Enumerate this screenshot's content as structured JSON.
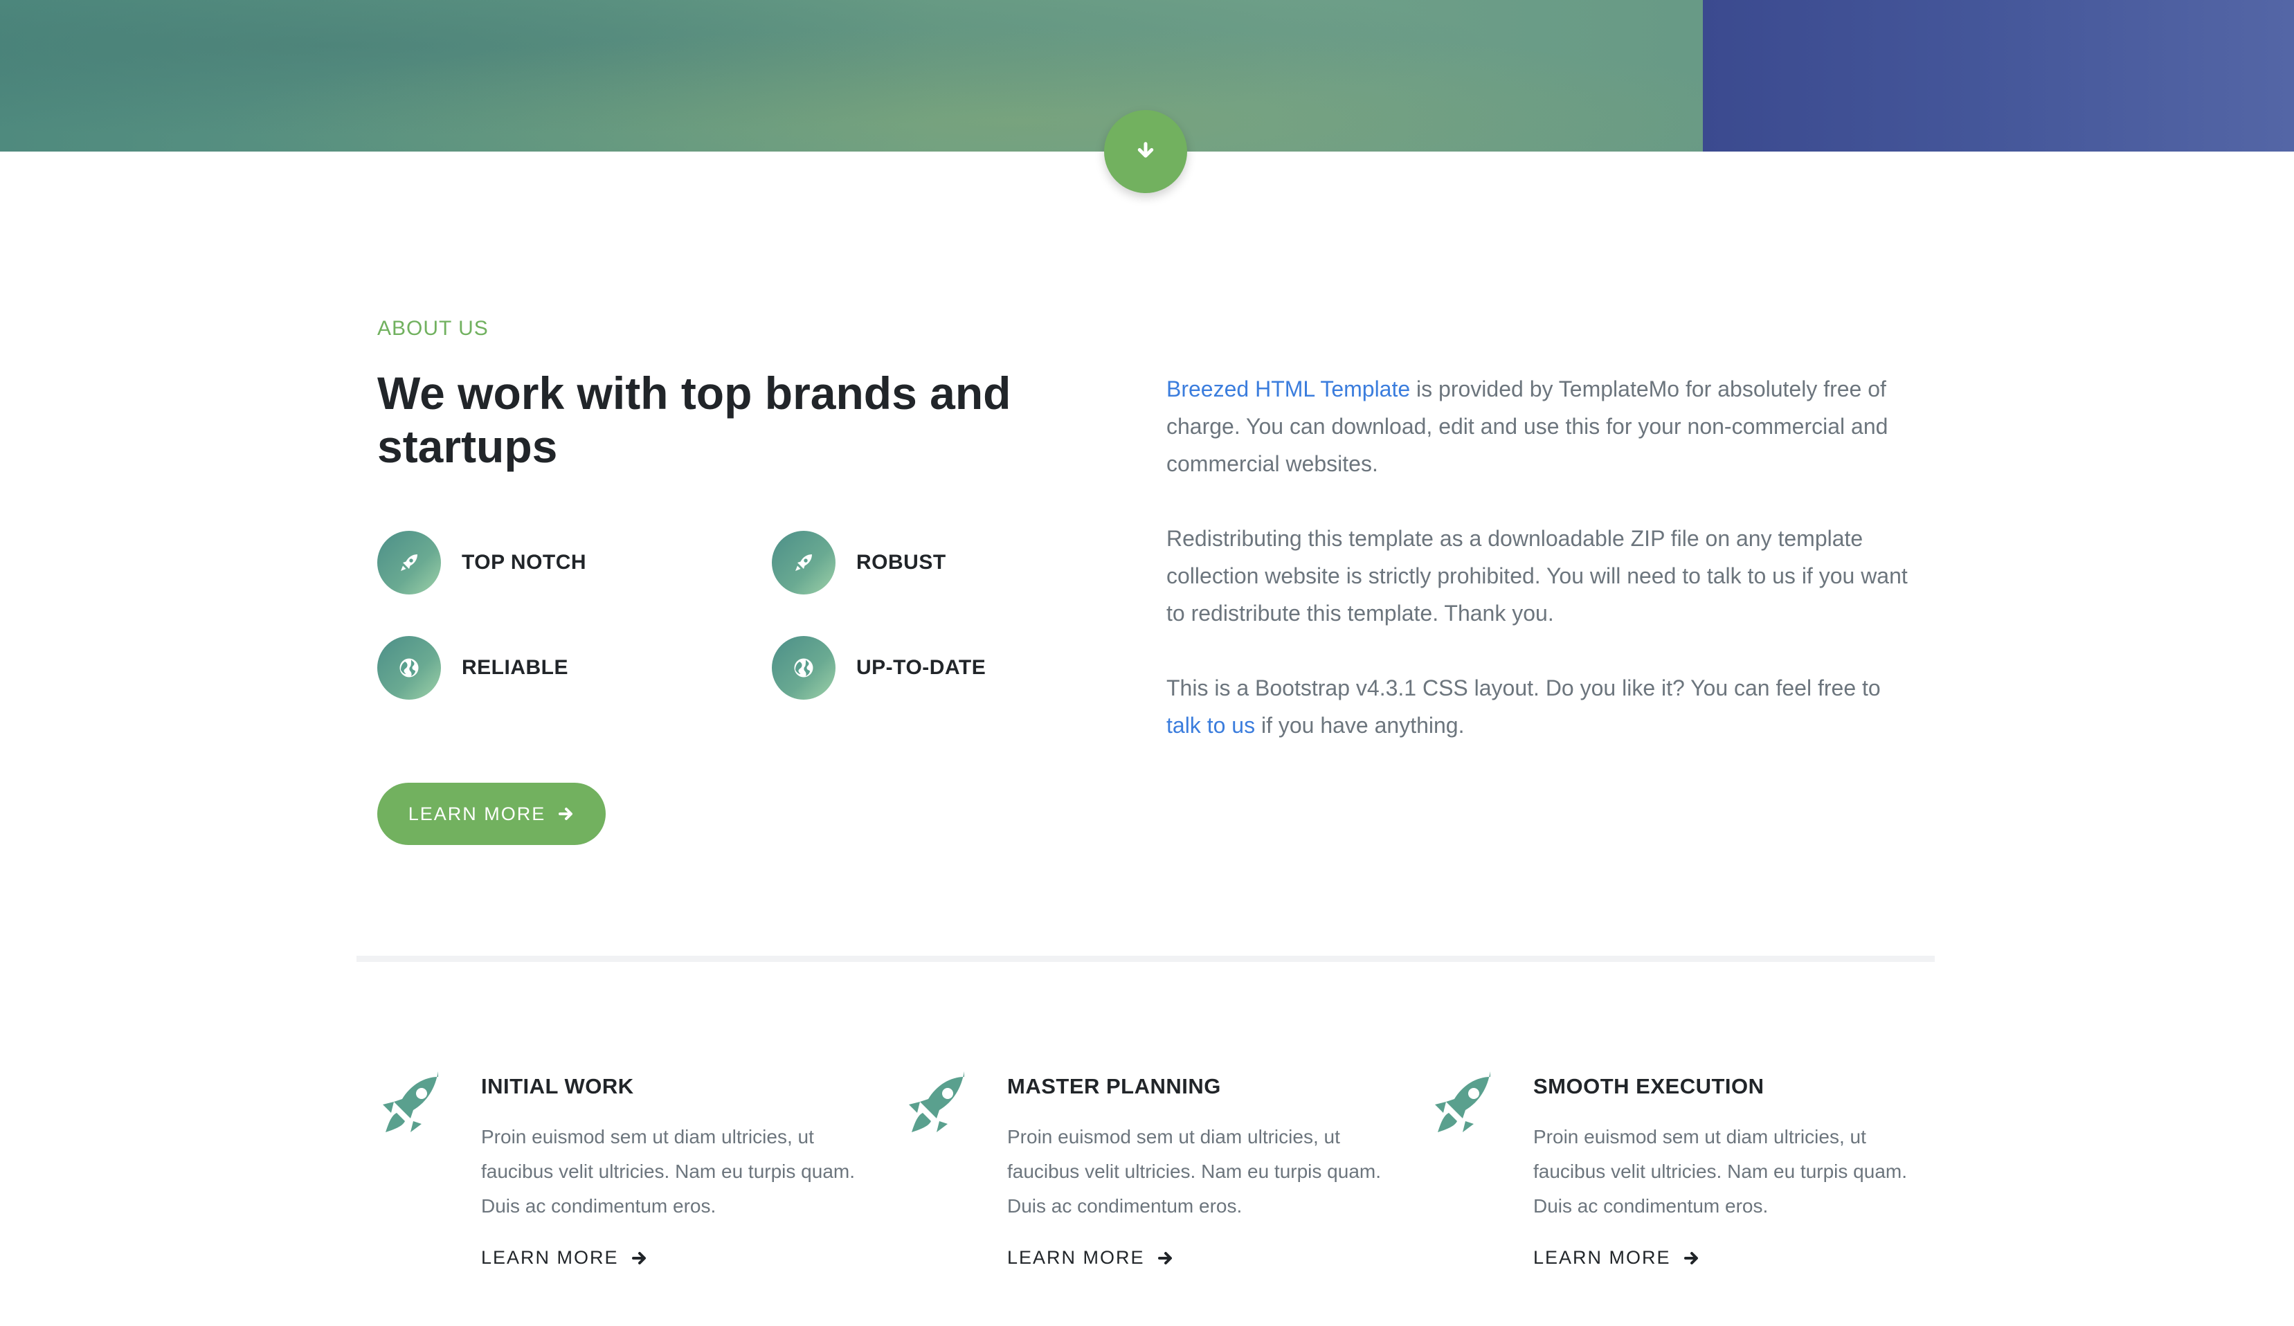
{
  "about": {
    "eyebrow": "ABOUT US",
    "headline": "We work with top brands and startups",
    "features": [
      {
        "label": "TOP NOTCH",
        "icon": "rocket-icon"
      },
      {
        "label": "ROBUST",
        "icon": "rocket-icon"
      },
      {
        "label": "RELIABLE",
        "icon": "globe-icon"
      },
      {
        "label": "UP-TO-DATE",
        "icon": "globe-icon"
      }
    ],
    "learn_more_label": "LEARN MORE",
    "paragraphs": {
      "p1_link": "Breezed HTML Template",
      "p1_text": " is provided by TemplateMo for absolutely free of charge. You can download, edit and use this for your non-commercial and commercial websites.",
      "p2_text": "Redistributing this template as a downloadable ZIP file on any template collection website is strictly prohibited. You will need to talk to us if you want to redistribute this template. Thank you.",
      "p3_text_before": "This is a Bootstrap v4.3.1 CSS layout. Do you like it? You can feel free to ",
      "p3_link": "talk to us",
      "p3_text_after": " if you have anything."
    }
  },
  "services": [
    {
      "title": "INITIAL WORK",
      "description": "Proin euismod sem ut diam ultricies, ut faucibus velit ultricies. Nam eu turpis quam. Duis ac condimentum eros.",
      "link_label": "LEARN MORE"
    },
    {
      "title": "MASTER PLANNING",
      "description": "Proin euismod sem ut diam ultricies, ut faucibus velit ultricies. Nam eu turpis quam. Duis ac condimentum eros.",
      "link_label": "LEARN MORE"
    },
    {
      "title": "SMOOTH EXECUTION",
      "description": "Proin euismod sem ut diam ultricies, ut faucibus velit ultricies. Nam eu turpis quam. Duis ac condimentum eros.",
      "link_label": "LEARN MORE"
    }
  ],
  "colors": {
    "accent_green": "#72b15f",
    "link_blue": "#3b7ddd",
    "text_dark": "#212529",
    "text_muted": "#6c757d",
    "icon_teal": "#5aa08e"
  }
}
